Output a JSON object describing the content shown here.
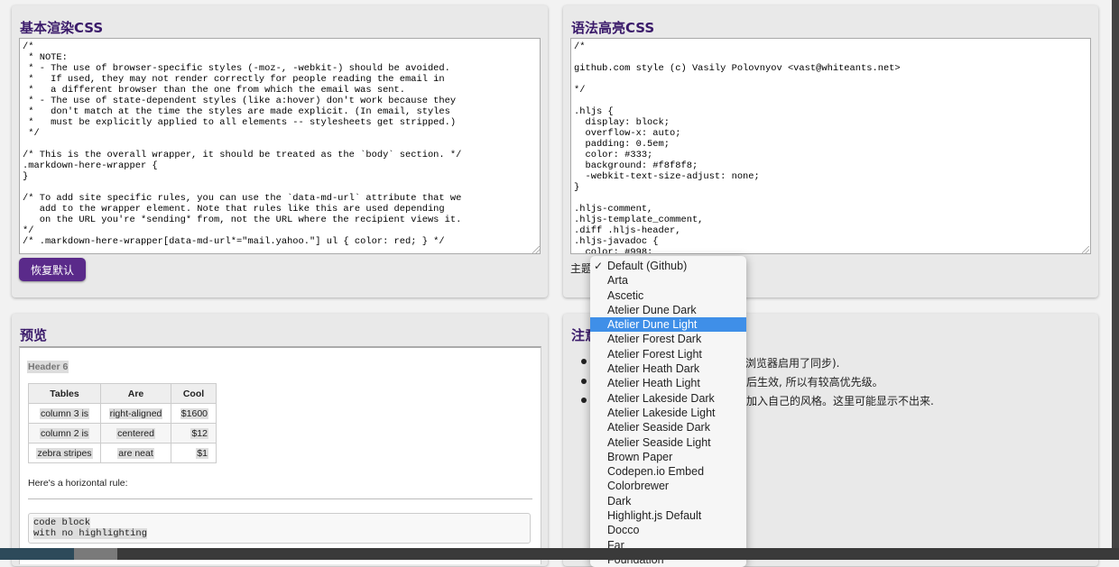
{
  "basic_css": {
    "title": "基本渲染CSS",
    "code": "/*\n * NOTE:\n * - The use of browser-specific styles (-moz-, -webkit-) should be avoided.\n *   If used, they may not render correctly for people reading the email in\n *   a different browser than the one from which the email was sent.\n * - The use of state-dependent styles (like a:hover) don't work because they\n *   don't match at the time the styles are made explicit. (In email, styles\n *   must be explicitly applied to all elements -- stylesheets get stripped.)\n */\n\n/* This is the overall wrapper, it should be treated as the `body` section. */\n.markdown-here-wrapper {\n}\n\n/* To add site specific rules, you can use the `data-md-url` attribute that we\n   add to the wrapper element. Note that rules like this are used depending\n   on the URL you're *sending* from, not the URL where the recipient views it.\n*/\n/* .markdown-here-wrapper[data-md-url*=\"mail.yahoo.\"] ul { color: red; } */",
    "reset_button": "恢复默认"
  },
  "syntax_css": {
    "title": "语法高亮CSS",
    "code": "/*\n\ngithub.com style (c) Vasily Polovnyov <vast@whiteants.net>\n\n*/\n\n.hljs {\n  display: block;\n  overflow-x: auto;\n  padding: 0.5em;\n  color: #333;\n  background: #f8f8f8;\n  -webkit-text-size-adjust: none;\n}\n\n.hljs-comment,\n.hljs-template_comment,\n.diff .hljs-header,\n.hljs-javadoc {\n  color: #998;",
    "theme_label": "主题",
    "theme_options": [
      "Default (Github)",
      "Arta",
      "Ascetic",
      "Atelier Dune Dark",
      "Atelier Dune Light",
      "Atelier Forest Dark",
      "Atelier Forest Light",
      "Atelier Heath Dark",
      "Atelier Heath Light",
      "Atelier Lakeside Dark",
      "Atelier Lakeside Light",
      "Atelier Seaside Dark",
      "Atelier Seaside Light",
      "Brown Paper",
      "Codepen.io Embed",
      "Colorbrewer",
      "Dark",
      "Highlight.js Default",
      "Docco",
      "Far",
      "Foundation"
    ],
    "checked_option": "Default (Github)",
    "highlighted_option": "Atelier Dune Light"
  },
  "preview": {
    "title": "预览",
    "header6": "Header 6",
    "table": {
      "headers": [
        "Tables",
        "Are",
        "Cool"
      ],
      "rows": [
        [
          "column 3 is",
          "right-aligned",
          "$1600"
        ],
        [
          "column 2 is",
          "centered",
          "$12"
        ],
        [
          "zebra stripes",
          "are neat",
          "$1"
        ]
      ]
    },
    "hr_text": "Here's a horizontal rule:",
    "code_line1": "code block",
    "code_line2": "with no highlighting"
  },
  "notes": {
    "title_partial": "注意",
    "line1": "的浏览器启用了同步).",
    "line2": "后生效, 所以有较高优先级。",
    "line3": "加入自己的风格。这里可能显示不出来."
  },
  "colors": {
    "accent": "#5a2a8a",
    "title": "#3a1a6a",
    "selection": "#3f8fe8"
  }
}
